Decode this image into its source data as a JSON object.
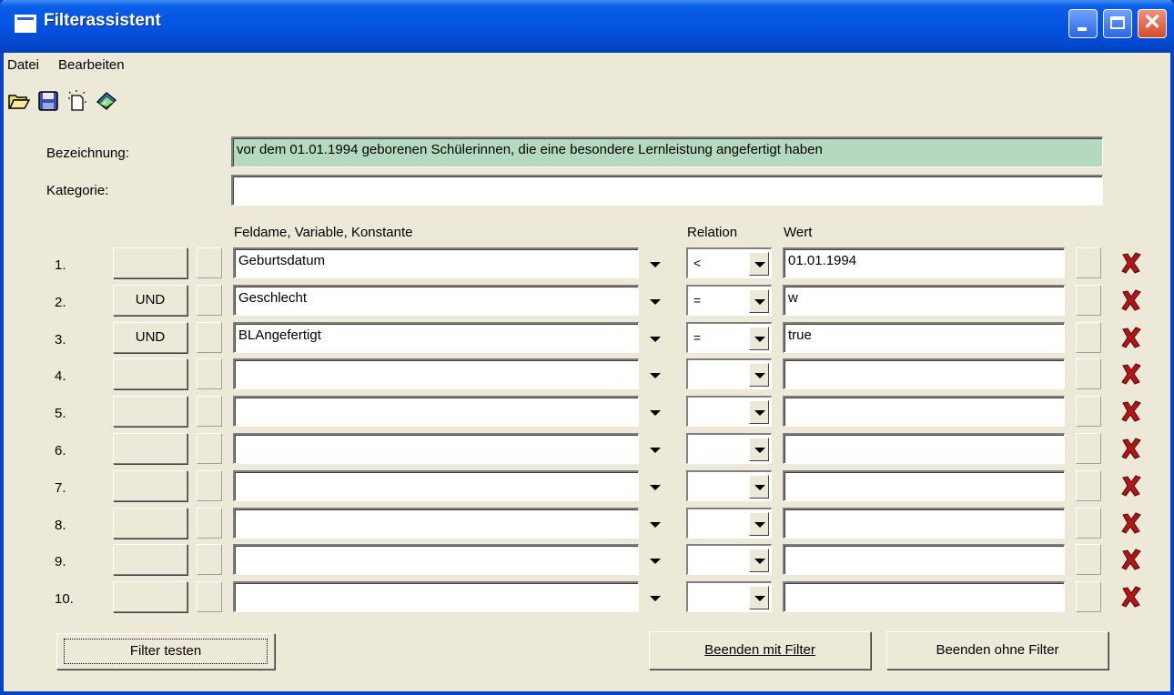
{
  "window": {
    "title": "Filterassistent"
  },
  "menu": [
    "Datei",
    "Bearbeiten"
  ],
  "toolbar": [
    "open-folder-icon",
    "save-disk-icon",
    "new-document-icon",
    "help-book-icon"
  ],
  "form": {
    "bezeichnung_label": "Bezeichnung:",
    "bezeichnung_value": "vor dem 01.01.1994 geborenen Schülerinnen, die eine besondere Lernleistung angefertigt haben",
    "kategorie_label": "Kategorie:",
    "kategorie_value": ""
  },
  "columns": {
    "feld": "Feldame, Variable, Konstante",
    "relation": "Relation",
    "wert": "Wert"
  },
  "rows": [
    {
      "num": "1.",
      "conj": "",
      "field": "Geburtsdatum",
      "relation": "<",
      "value": "01.01.1994"
    },
    {
      "num": "2.",
      "conj": "UND",
      "field": "Geschlecht",
      "relation": "=",
      "value": "w"
    },
    {
      "num": "3.",
      "conj": "UND",
      "field": "BLAngefertigt",
      "relation": "=",
      "value": "true"
    },
    {
      "num": "4.",
      "conj": "",
      "field": "",
      "relation": "",
      "value": ""
    },
    {
      "num": "5.",
      "conj": "",
      "field": "",
      "relation": "",
      "value": ""
    },
    {
      "num": "6.",
      "conj": "",
      "field": "",
      "relation": "",
      "value": ""
    },
    {
      "num": "7.",
      "conj": "",
      "field": "",
      "relation": "",
      "value": ""
    },
    {
      "num": "8.",
      "conj": "",
      "field": "",
      "relation": "",
      "value": ""
    },
    {
      "num": "9.",
      "conj": "",
      "field": "",
      "relation": "",
      "value": ""
    },
    {
      "num": "10.",
      "conj": "",
      "field": "",
      "relation": "",
      "value": ""
    }
  ],
  "buttons": {
    "test": "Filter testen",
    "end_with": "Beenden mit Filter",
    "end_without": "Beenden ohne Filter"
  },
  "colors": {
    "titlebar": "#0553e2",
    "delete_icon": "#b01818",
    "name_field_bg": "#b4d9bf",
    "window_bg": "#ece9d8"
  }
}
